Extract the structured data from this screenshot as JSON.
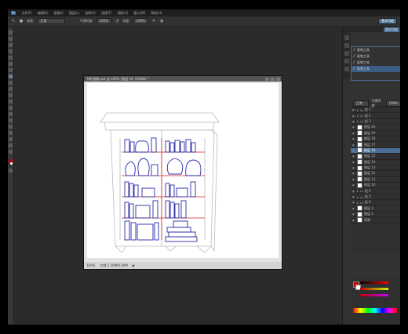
{
  "menubar": {
    "items": [
      "文件(F)",
      "编辑(E)",
      "图像(I)",
      "图层(L)",
      "选择(S)",
      "滤镜(T)",
      "视图(V)",
      "窗口(W)",
      "帮助(H)"
    ]
  },
  "options": {
    "mode_label": "画笔:",
    "mode_value": "正常",
    "opacity_label": "不透明度:",
    "opacity_value": "100%",
    "flow_label": "流量:",
    "flow_value": "100%"
  },
  "document": {
    "title": "书柜线稿.psd @ 100% (图层 16, RGB/8) *",
    "zoom": "100%",
    "doc_size": "文档:1.50M/6.00M"
  },
  "dock": {
    "active_tab": "基本功能"
  },
  "history": {
    "items": [
      "画笔工具",
      "画笔工具",
      "画笔工具",
      "画笔工具"
    ],
    "selected": 3
  },
  "layers": {
    "blend": "正常",
    "opacity_label": "不透明度:",
    "opacity": "100%",
    "rows": [
      {
        "name": "组 1",
        "type": "group"
      },
      {
        "name": "组 2",
        "type": "group"
      },
      {
        "name": "组 3",
        "type": "group"
      },
      {
        "name": "图层 20",
        "type": "layer"
      },
      {
        "name": "图层 19",
        "type": "layer"
      },
      {
        "name": "图层 18",
        "type": "layer"
      },
      {
        "name": "图层 17",
        "type": "layer"
      },
      {
        "name": "图层 16",
        "type": "layer",
        "selected": true
      },
      {
        "name": "图层 15",
        "type": "layer"
      },
      {
        "name": "图层 14",
        "type": "layer"
      },
      {
        "name": "图层 13",
        "type": "layer"
      },
      {
        "name": "图层 12",
        "type": "layer"
      },
      {
        "name": "图层 11",
        "type": "layer"
      },
      {
        "name": "图层 10",
        "type": "layer"
      },
      {
        "name": "组 4",
        "type": "group"
      },
      {
        "name": "组 5",
        "type": "group"
      },
      {
        "name": "组 6",
        "type": "group"
      },
      {
        "name": "图层 2",
        "type": "layer"
      },
      {
        "name": "图层 1",
        "type": "layer"
      },
      {
        "name": "背景",
        "type": "layer"
      }
    ]
  },
  "colors": {
    "accent": "#4b6d97",
    "foreground": "#c00000",
    "background": "#ffffff",
    "sketch_blue": "#2a2aa8",
    "sketch_red": "#d42020",
    "outline": "#b8b8b8"
  }
}
